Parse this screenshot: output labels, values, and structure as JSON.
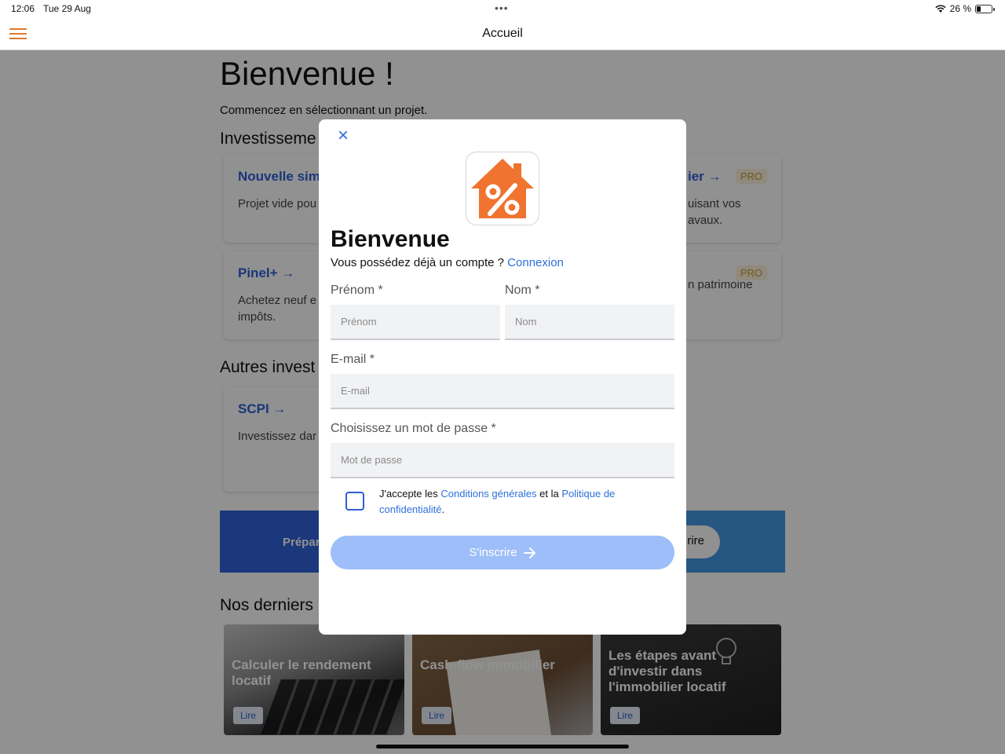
{
  "status": {
    "time": "12:06",
    "date": "Tue 29 Aug",
    "battery": "26 %",
    "battery_level": 0.26
  },
  "nav": {
    "title": "Accueil"
  },
  "home": {
    "welcome": "Bienvenue !",
    "subtitle": "Commencez en sélectionnant un projet.",
    "section1": "Investisseme",
    "section2": "Autres invest",
    "section3": "Nos derniers",
    "cards": [
      {
        "title": "Nouvelle sim",
        "desc": "Projet vide pou de zéro."
      },
      {
        "title": "ier →",
        "desc": "uisant vos avaux.",
        "badge": "PRO"
      },
      {
        "title": "Pinel+ →",
        "desc": "Achetez neuf e vos impôts."
      },
      {
        "title": "",
        "desc": "n patrimoine",
        "badge": "PRO"
      },
      {
        "title": "SCPI →",
        "desc": "Investissez dar papier."
      }
    ],
    "cta_left": "Prépar",
    "cta_right": "rire",
    "articles": [
      {
        "title": "Calculer le rendement locatif",
        "button": "Lire"
      },
      {
        "title": "Cash-flow immobilier",
        "button": "Lire"
      },
      {
        "title": "Les étapes avant d'investir dans l'immobilier locatif",
        "button": "Lire"
      }
    ]
  },
  "modal": {
    "close_icon": "×",
    "logo_icon": "house-percent-icon",
    "logo_color": "#f07330",
    "title": "Bienvenue",
    "have_account": "Vous possédez déjà un compte ?",
    "login_link": "Connexion",
    "firstname_label": "Prénom *",
    "firstname_placeholder": "Prénom",
    "lastname_label": "Nom *",
    "lastname_placeholder": "Nom",
    "email_label": "E-mail *",
    "email_placeholder": "E-mail",
    "password_label": "Choisissez un mot de passe *",
    "password_placeholder": "Mot de passe",
    "terms_prefix": "J'accepte les",
    "terms_link1": "Conditions générales",
    "terms_middle": "et la",
    "terms_link2": "Politique de confidentialité",
    "terms_suffix": ".",
    "submit_label": "S'inscrire",
    "submit_color": "#9dbef9"
  }
}
